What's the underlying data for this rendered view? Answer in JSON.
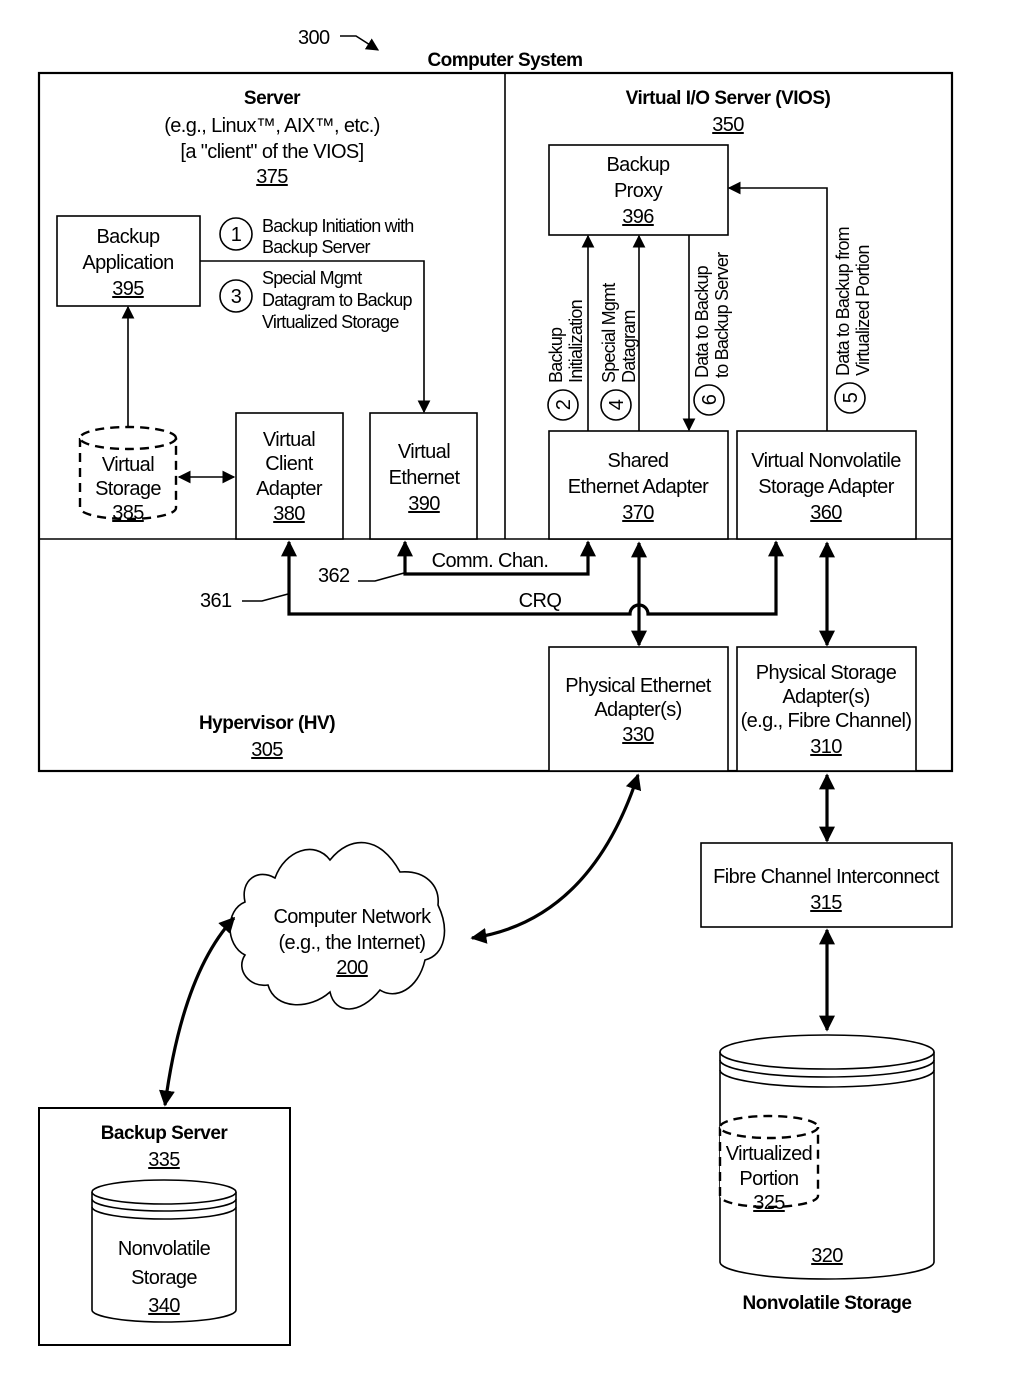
{
  "figure": {
    "ref_number": "300",
    "title": "Computer System"
  },
  "server": {
    "title": "Server",
    "subtitle": "(e.g., Linux™, AIX™, etc.)",
    "note": "[a \"client\" of the VIOS]",
    "ref": "375"
  },
  "vios": {
    "title": "Virtual I/O Server (VIOS)",
    "ref": "350"
  },
  "hypervisor": {
    "title": "Hypervisor (HV)",
    "ref": "305"
  },
  "components": {
    "backup_application": {
      "line1": "Backup",
      "line2": "Application",
      "ref": "395"
    },
    "virtual_storage": {
      "line1": "Virtual",
      "line2": "Storage",
      "ref": "385"
    },
    "virtual_client_adapter": {
      "line1": "Virtual",
      "line2": "Client",
      "line3": "Adapter",
      "ref": "380"
    },
    "virtual_ethernet": {
      "line1": "Virtual",
      "line2": "Ethernet",
      "ref": "390"
    },
    "backup_proxy": {
      "line1": "Backup",
      "line2": "Proxy",
      "ref": "396"
    },
    "shared_ethernet_adapter": {
      "line1": "Shared",
      "line2": "Ethernet Adapter",
      "ref": "370"
    },
    "virtual_nonvolatile_storage_adapter": {
      "line1": "Virtual Nonvolatile",
      "line2": "Storage Adapter",
      "ref": "360"
    },
    "physical_ethernet_adapter": {
      "line1": "Physical Ethernet",
      "line2": "Adapter(s)",
      "ref": "330"
    },
    "physical_storage_adapter": {
      "line1": "Physical Storage",
      "line2": "Adapter(s)",
      "line3": "(e.g., Fibre Channel)",
      "ref": "310"
    },
    "fibre_channel_interconnect": {
      "line1": "Fibre Channel Interconnect",
      "ref": "315"
    },
    "computer_network": {
      "line1": "Computer Network",
      "line2": "(e.g., the Internet)",
      "ref": "200"
    },
    "backup_server": {
      "title": "Backup Server",
      "ref": "335"
    },
    "backup_nonvolatile_storage": {
      "line1": "Nonvolatile",
      "line2": "Storage",
      "ref": "340"
    },
    "nonvolatile_storage": {
      "title": "Nonvolatile Storage",
      "ref": "320"
    },
    "virtualized_portion": {
      "line1": "Virtualized",
      "line2": "Portion",
      "ref": "325"
    }
  },
  "channels": {
    "comm_chan": {
      "label": "Comm. Chan.",
      "ref": "362"
    },
    "crq": {
      "label": "CRQ",
      "ref": "361"
    }
  },
  "steps": [
    {
      "num": "1",
      "line1": "Backup Initiation with",
      "line2": "Backup Server"
    },
    {
      "num": "2",
      "line1": "Backup",
      "line2": "Initialization"
    },
    {
      "num": "3",
      "line1": "Special Mgmt",
      "line2": "Datagram to Backup",
      "line3": "Virtualized Storage"
    },
    {
      "num": "4",
      "line1": "Special Mgmt",
      "line2": "Datagram"
    },
    {
      "num": "5",
      "line1": "Data to Backup from",
      "line2": "Virtualized Portion"
    },
    {
      "num": "6",
      "line1": "Data to Backup",
      "line2": "to Backup Server"
    }
  ]
}
